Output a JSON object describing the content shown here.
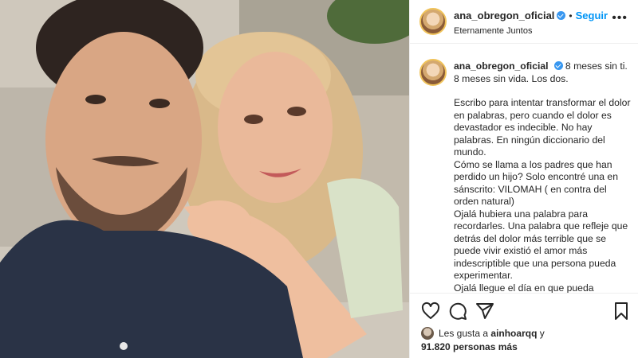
{
  "header": {
    "username": "ana_obregon_oficial",
    "follow_label": "Seguir",
    "location": "Eternamente Juntos",
    "more_icon": "more-options-icon"
  },
  "caption": {
    "username": "ana_obregon_oficial",
    "lines": [
      "8 meses sin ti.",
      "8 meses sin vida. Los dos.",
      "",
      "Escribo para intentar transformar el dolor en palabras, pero cuando el dolor es devastador es indecible. No hay palabras. En ningún diccionario del mundo.",
      "Cómo se llama a los padres que han perdido un hijo? Solo encontré una en sánscrito: VILOMAH ( en contra del orden natural)",
      "Ojalá hubiera una palabra para recordarles. Una palabra que refleje que detrás del dolor más terrible que se puede vivir existió el amor más indescriptible que una persona pueda experimentar.",
      "Ojalá llegue el día en que pueda"
    ]
  },
  "actions": {
    "like_icon": "heart-icon",
    "comment_icon": "comment-icon",
    "share_icon": "share-icon",
    "save_icon": "bookmark-icon"
  },
  "likes": {
    "prefix": "Les gusta a",
    "first_user": "ainhoarqq",
    "connector": "y",
    "others": "91.820 personas más"
  },
  "colors": {
    "accent": "#0095f6",
    "verified": "#3897f0",
    "text": "#262626",
    "border": "#efefef"
  }
}
